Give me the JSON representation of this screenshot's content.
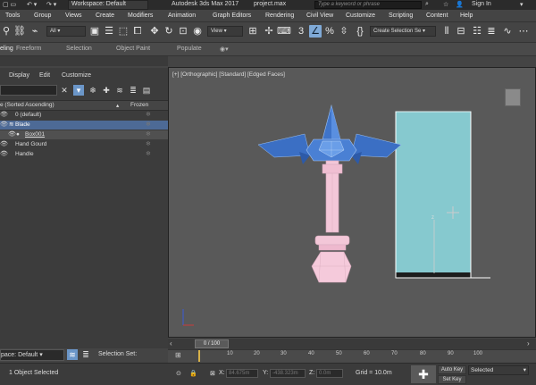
{
  "title_bar": {
    "workspace": "Workspace: Default",
    "app_title": "Autodesk 3ds Max 2017",
    "file_name": "project.max",
    "search_placeholder": "Type a keyword or phrase",
    "sign_in": "Sign In"
  },
  "menu": [
    "Tools",
    "Group",
    "Views",
    "Create",
    "Modifiers",
    "Animation",
    "Graph Editors",
    "Rendering",
    "Civil View",
    "Customize",
    "Scripting",
    "Content",
    "Help"
  ],
  "toolbar": {
    "selection_filter": "All",
    "ref_coord": "View",
    "create_selection_set": "Create Selection Se"
  },
  "ribbon": {
    "tab_partial": "eling",
    "tabs": [
      "Freeform",
      "Selection",
      "Object Paint",
      "Populate"
    ]
  },
  "scene_explorer": {
    "menu": [
      "Display",
      "Edit",
      "Customize"
    ],
    "header_name": "e (Sorted Ascending)",
    "header_frozen": "Frozen",
    "rows": [
      {
        "name": "0 (default)"
      },
      {
        "name": "Blade"
      },
      {
        "name": "Box001"
      },
      {
        "name": "Hand Gourd"
      },
      {
        "name": "Handle"
      }
    ]
  },
  "layer_dropdown": "pace: Default",
  "selection_set_label": "Selection Set:",
  "viewport": {
    "label": "[+] [Orthographic] [Standard] [Edged Faces]",
    "axis_z": "z"
  },
  "timeline": {
    "slider": "0 / 100",
    "ticks": [
      "10",
      "20",
      "30",
      "40",
      "50",
      "60",
      "70",
      "80",
      "90",
      "100"
    ]
  },
  "status": {
    "selected": "1 Object Selected",
    "x_label": "X:",
    "x_value": "84.675m",
    "y_label": "Y:",
    "y_value": "-438.323m",
    "z_label": "Z:",
    "z_value": "0.0m",
    "grid": "Grid = 10.0m",
    "autokey": "Auto Key",
    "key_mode": "Selected",
    "set_key": "Set Key"
  }
}
